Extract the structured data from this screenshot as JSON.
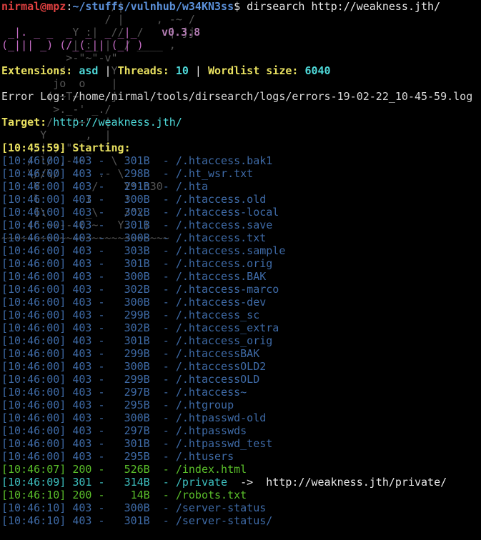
{
  "prompt": {
    "user_host": "nirmal@mpz",
    "sep": ":",
    "path": "~/stuffs/vulnhub/w34KN3ss",
    "dollar": "$",
    "command": " dirsearch http://weakness.jth/"
  },
  "banner": {
    "logo_line1": " _|. _ _  _  _  _ _|_    ",
    "logo_line2": "(_||| _) (/_(_|| (_| )   ",
    "version": "v0.3.8"
  },
  "config": {
    "ext_label": "Extensions:",
    "ext_value": "asd",
    "threads_label": "Threads:",
    "threads_value": "10",
    "wordlist_label": "Wordlist size:",
    "wordlist_value": "6040",
    "sep": " | "
  },
  "error_log": "Error Log: /home/nirmal/tools/dirsearch/logs/errors-19-02-22_10-45-59.log",
  "target": {
    "label": "Target:",
    "url": "http://weakness.jth/"
  },
  "starting": "[10:45:59] Starting:",
  "results": [
    {
      "time": "[10:46:00]",
      "code": "403",
      "size": "301B",
      "path": "/.htaccess.bak1",
      "kind": "forbidden"
    },
    {
      "time": "[10:46:00]",
      "code": "403",
      "size": "298B",
      "path": "/.ht_wsr.txt",
      "kind": "forbidden"
    },
    {
      "time": "[10:46:00]",
      "code": "403",
      "size": "291B",
      "path": "/.hta",
      "kind": "forbidden"
    },
    {
      "time": "[10:46:00]",
      "code": "403",
      "size": "300B",
      "path": "/.htaccess.old",
      "kind": "forbidden"
    },
    {
      "time": "[10:46:00]",
      "code": "403",
      "size": "302B",
      "path": "/.htaccess-local",
      "kind": "forbidden"
    },
    {
      "time": "[10:46:00]",
      "code": "403",
      "size": "301B",
      "path": "/.htaccess.save",
      "kind": "forbidden"
    },
    {
      "time": "[10:46:00]",
      "code": "403",
      "size": "300B",
      "path": "/.htaccess.txt",
      "kind": "forbidden"
    },
    {
      "time": "[10:46:00]",
      "code": "403",
      "size": "303B",
      "path": "/.htaccess.sample",
      "kind": "forbidden"
    },
    {
      "time": "[10:46:00]",
      "code": "403",
      "size": "301B",
      "path": "/.htaccess.orig",
      "kind": "forbidden"
    },
    {
      "time": "[10:46:00]",
      "code": "403",
      "size": "300B",
      "path": "/.htaccess.BAK",
      "kind": "forbidden"
    },
    {
      "time": "[10:46:00]",
      "code": "403",
      "size": "302B",
      "path": "/.htaccess-marco",
      "kind": "forbidden"
    },
    {
      "time": "[10:46:00]",
      "code": "403",
      "size": "300B",
      "path": "/.htaccess-dev",
      "kind": "forbidden"
    },
    {
      "time": "[10:46:00]",
      "code": "403",
      "size": "299B",
      "path": "/.htaccess_sc",
      "kind": "forbidden"
    },
    {
      "time": "[10:46:00]",
      "code": "403",
      "size": "302B",
      "path": "/.htaccess_extra",
      "kind": "forbidden"
    },
    {
      "time": "[10:46:00]",
      "code": "403",
      "size": "301B",
      "path": "/.htaccess_orig",
      "kind": "forbidden"
    },
    {
      "time": "[10:46:00]",
      "code": "403",
      "size": "299B",
      "path": "/.htaccessBAK",
      "kind": "forbidden"
    },
    {
      "time": "[10:46:00]",
      "code": "403",
      "size": "300B",
      "path": "/.htaccessOLD2",
      "kind": "forbidden"
    },
    {
      "time": "[10:46:00]",
      "code": "403",
      "size": "299B",
      "path": "/.htaccessOLD",
      "kind": "forbidden"
    },
    {
      "time": "[10:46:00]",
      "code": "403",
      "size": "297B",
      "path": "/.htaccess~",
      "kind": "forbidden"
    },
    {
      "time": "[10:46:00]",
      "code": "403",
      "size": "295B",
      "path": "/.htgroup",
      "kind": "forbidden"
    },
    {
      "time": "[10:46:00]",
      "code": "403",
      "size": "300B",
      "path": "/.htpasswd-old",
      "kind": "forbidden"
    },
    {
      "time": "[10:46:00]",
      "code": "403",
      "size": "297B",
      "path": "/.htpasswds",
      "kind": "forbidden"
    },
    {
      "time": "[10:46:00]",
      "code": "403",
      "size": "301B",
      "path": "/.htpasswd_test",
      "kind": "forbidden"
    },
    {
      "time": "[10:46:00]",
      "code": "403",
      "size": "295B",
      "path": "/.htusers",
      "kind": "forbidden"
    },
    {
      "time": "[10:46:07]",
      "code": "200",
      "size": "526B",
      "path": "/index.html",
      "kind": "ok"
    },
    {
      "time": "[10:46:09]",
      "code": "301",
      "size": "314B",
      "path": "/private",
      "kind": "redirect",
      "redirect": "http://weakness.jth/private/"
    },
    {
      "time": "[10:46:10]",
      "code": "200",
      "size": "14B",
      "path": "/robots.txt",
      "kind": "ok"
    },
    {
      "time": "[10:46:10]",
      "code": "403",
      "size": "300B",
      "path": "/server-status",
      "kind": "forbidden"
    },
    {
      "time": "[10:46:10]",
      "code": "403",
      "size": "301B",
      "path": "/server-status/",
      "kind": "forbidden"
    }
  ],
  "colors": {
    "background": "#000000",
    "forbidden": "#3e6aa6",
    "ok": "#5abf2a",
    "redirect": "#3dbfbf",
    "prompt_user": "#e04040",
    "prompt_path": "#5a8fd8",
    "label_yellow": "#e8e060",
    "value_cyan": "#4ed8d8"
  }
}
